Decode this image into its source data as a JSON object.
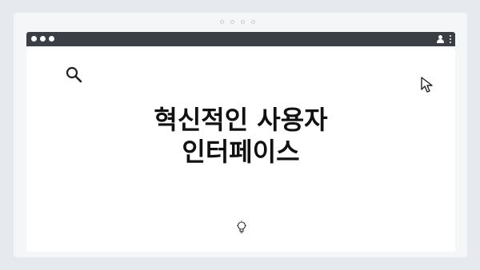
{
  "headline": {
    "line1": "혁신적인 사용자",
    "line2": "인터페이스"
  },
  "icons": {
    "search": "search-icon",
    "cursor": "cursor-arrow-icon",
    "lightbulb": "lightbulb-icon",
    "user": "user-icon",
    "menu": "kebab-menu-icon"
  },
  "colors": {
    "page_background": "#e6e9ed",
    "titlebar": "#3b3f45",
    "window": "#ffffff",
    "headline_text": "#111111"
  }
}
